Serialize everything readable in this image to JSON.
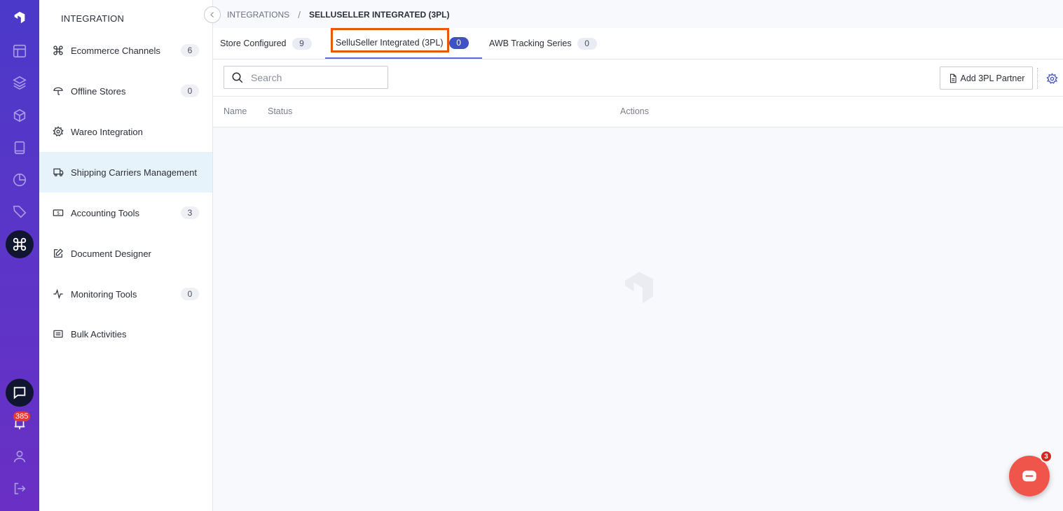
{
  "rail": {
    "icons": [
      "logo-icon",
      "layout-icon",
      "layers-icon",
      "box-icon",
      "book-icon",
      "pie-chart-icon",
      "tag-icon",
      "command-icon",
      "chat-icon",
      "notification-icon",
      "user-icon",
      "logout-icon"
    ],
    "notification_count": "385",
    "colors": {
      "rail_top": "#4b39c9",
      "rail_bottom": "#6a2fc4",
      "active": "#101530"
    }
  },
  "sidebar": {
    "title": "INTEGRATION",
    "items": [
      {
        "label": "Ecommerce Channels",
        "count": "6",
        "icon": "command-icon"
      },
      {
        "label": "Offline Stores",
        "count": "0",
        "icon": "store-icon"
      },
      {
        "label": "Wareo Integration",
        "count": "",
        "icon": "gear-icon"
      },
      {
        "label": "Shipping Carriers Management",
        "count": "",
        "icon": "truck-icon",
        "active": true
      },
      {
        "label": "Accounting Tools",
        "count": "3",
        "icon": "cash-icon"
      },
      {
        "label": "Document Designer",
        "count": "",
        "icon": "edit-icon"
      },
      {
        "label": "Monitoring Tools",
        "count": "0",
        "icon": "activity-icon"
      },
      {
        "label": "Bulk Activities",
        "count": "",
        "icon": "list-icon"
      }
    ]
  },
  "breadcrumb": {
    "root": "INTEGRATIONS",
    "separator": "/",
    "current": "SELLUSELLER INTEGRATED (3PL)"
  },
  "tabs": [
    {
      "label": "Store Configured",
      "count": "9"
    },
    {
      "label": "SelluSeller Integrated (3PL)",
      "count": "0",
      "selected": true
    },
    {
      "label": "AWB Tracking Series",
      "count": "0"
    }
  ],
  "toolbar": {
    "search_placeholder": "Search",
    "add_button_label": "Add 3PL Partner"
  },
  "table": {
    "columns": [
      "Name",
      "Status",
      "Actions"
    ],
    "rows": []
  },
  "fab": {
    "badge": "3",
    "color": "#f0554b"
  },
  "accent": {
    "highlight": "#e8590c",
    "tab_selected": "#3f51c4"
  }
}
